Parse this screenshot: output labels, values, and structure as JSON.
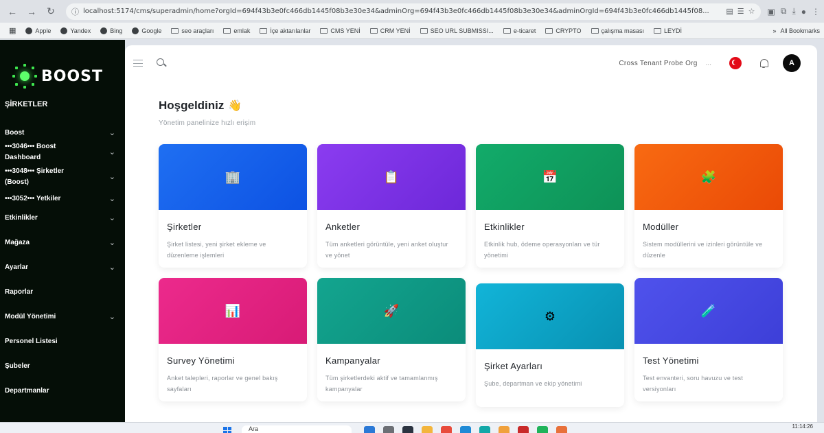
{
  "browser": {
    "url": "localhost:5174/cms/superadmin/home?orgId=694f43b3e0fc466db1445f08b3e30e34&adminOrg=694f43b3e0fc466db1445f08b3e30e34&adminOrgId=694f43b3e0fc466db1445f08...",
    "bookmarks": [
      "Apple",
      "Yandex",
      "Bing",
      "Google",
      "seo araçları",
      "emlak",
      "İçe aktarılanlar",
      "CMS YENİ",
      "CRM YENİ",
      "SEO URL SUBMISSI...",
      "e-ticaret",
      "CRYPTO",
      "çalışma masası",
      "LEYDİ"
    ],
    "all_bookmarks": "All Bookmarks"
  },
  "sidebar": {
    "logo": "BOOST",
    "heading": "ŞİRKETLER",
    "items": [
      {
        "label": "Boost",
        "chevron": true
      },
      {
        "label": "•••3046••• Boost Dashboard",
        "chevron": true
      },
      {
        "label": "•••3048••• Şirketler (Boost)",
        "chevron": true
      },
      {
        "label": "•••3052••• Yetkiler",
        "chevron": true
      },
      {
        "label": "Etkinlikler",
        "chevron": true
      },
      {
        "label": "Mağaza",
        "chevron": true
      },
      {
        "label": "Ayarlar",
        "chevron": true
      },
      {
        "label": "Raporlar",
        "chevron": false
      },
      {
        "label": "Modül Yönetimi",
        "chevron": true
      },
      {
        "label": "Personel Listesi",
        "chevron": false
      },
      {
        "label": "Şubeler",
        "chevron": false
      },
      {
        "label": "Departmanlar",
        "chevron": false
      }
    ]
  },
  "header": {
    "org_name": "Cross Tenant Probe Org",
    "ellipsis": "...",
    "avatar_initial": "A"
  },
  "welcome": {
    "title": "Hoşgeldiniz",
    "subtitle": "Yönetim panelinize hızlı erişim"
  },
  "cards": [
    {
      "title": "Şirketler",
      "description": "Şirket listesi, yeni şirket ekleme ve düzenleme işlemleri",
      "icon": "building-icon",
      "color_from": "#1f6ff2",
      "color_to": "#0d52e3"
    },
    {
      "title": "Anketler",
      "description": "Tüm anketleri görüntüle, yeni anket oluştur ve yönet",
      "icon": "clipboard-icon",
      "color_from": "#8b3cf0",
      "color_to": "#6d28d9"
    },
    {
      "title": "Etkinlikler",
      "description": "Etkinlik hub, ödeme operasyonları ve tür yönetimi",
      "icon": "calendar-icon",
      "color_from": "#12ab6a",
      "color_to": "#0e9257"
    },
    {
      "title": "Modüller",
      "description": "Sistem modüllerini ve izinleri görüntüle ve düzenle",
      "icon": "puzzle-icon",
      "color_from": "#f86a12",
      "color_to": "#ea4a06"
    },
    {
      "title": "Survey Yönetimi",
      "description": "Anket talepleri, raporlar ve genel bakış sayfaları",
      "icon": "bar-chart-icon",
      "color_from": "#ec2a8c",
      "color_to": "#d81b76"
    },
    {
      "title": "Kampanyalar",
      "description": "Tüm şirketlerdeki aktif ve tamamlanmış kampanyalar",
      "icon": "rocket-icon",
      "color_from": "#13a58f",
      "color_to": "#0b8c7a"
    },
    {
      "title": "Şirket Ayarları",
      "description": "Şube, departman ve ekip yönetimi",
      "icon": "gear-icon",
      "color_from": "#12b4d8",
      "color_to": "#0891b2"
    },
    {
      "title": "Test Yönetimi",
      "description": "Test envanteri, soru havuzu ve test versiyonları",
      "icon": "test-tube-icon",
      "color_from": "#4f52ec",
      "color_to": "#3d3fd8"
    }
  ],
  "taskbar": {
    "search_placeholder": "Ara",
    "time": "11:14:26"
  }
}
